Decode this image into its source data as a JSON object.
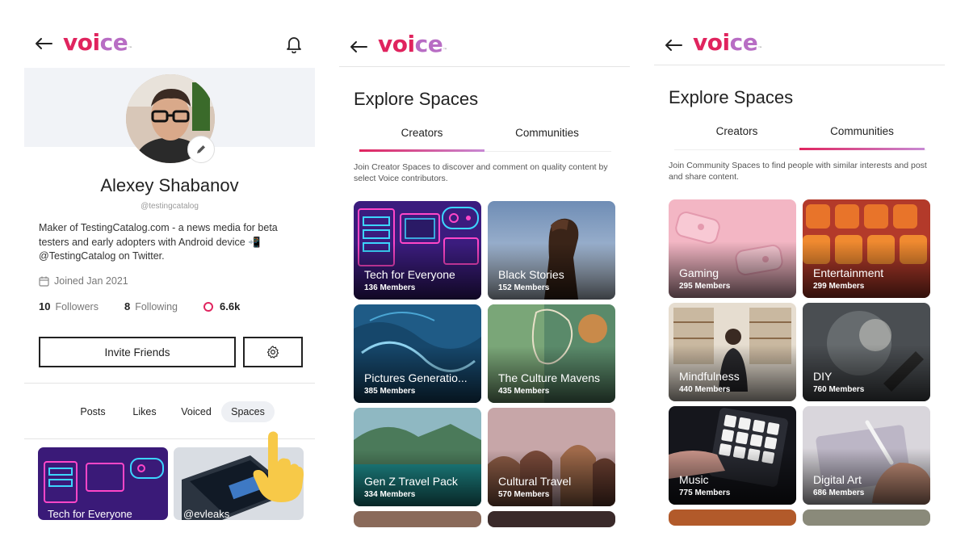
{
  "brand": {
    "logo_a": "voi",
    "logo_b": "ce",
    "tm": "™"
  },
  "profile": {
    "name": "Alexey Shabanov",
    "handle": "@testingcatalog",
    "bio": "Maker of TestingCatalog.com - a news media for beta testers and early adopters with Android device 📲 @TestingCatalog on Twitter.",
    "joined": "Joined Jan 2021",
    "followers_count": "10",
    "followers_label": "Followers",
    "following_count": "8",
    "following_label": "Following",
    "points": "6.6k",
    "invite_label": "Invite Friends",
    "tabs": [
      "Posts",
      "Likes",
      "Voiced",
      "Spaces"
    ],
    "thumbs": [
      {
        "title": "Tech for Everyone"
      },
      {
        "title": "@evleaks"
      }
    ]
  },
  "creators_screen": {
    "title": "Explore Spaces",
    "tabs": [
      "Creators",
      "Communities"
    ],
    "active_tab": "Creators",
    "description": "Join Creator Spaces to discover and comment on quality content by select Voice contributors.",
    "cards": [
      {
        "title": "Tech for Everyone",
        "members": "136 Members"
      },
      {
        "title": "Black Stories",
        "members": "152 Members"
      },
      {
        "title": "Pictures Generatio...",
        "members": "385 Members"
      },
      {
        "title": "The Culture Mavens",
        "members": "435 Members"
      },
      {
        "title": "Gen Z Travel Pack",
        "members": "334 Members"
      },
      {
        "title": "Cultural Travel",
        "members": "570 Members"
      }
    ]
  },
  "communities_screen": {
    "title": "Explore Spaces",
    "tabs": [
      "Creators",
      "Communities"
    ],
    "active_tab": "Communities",
    "description": "Join Community Spaces to find people with similar interests and post and share content.",
    "cards": [
      {
        "title": "Gaming",
        "members": "295 Members"
      },
      {
        "title": "Entertainment",
        "members": "299 Members"
      },
      {
        "title": "Mindfulness",
        "members": "440 Members"
      },
      {
        "title": "DIY",
        "members": "760 Members"
      },
      {
        "title": "Music",
        "members": "775 Members"
      },
      {
        "title": "Digital Art",
        "members": "686 Members"
      }
    ]
  },
  "colors": {
    "accent": "#e0245e",
    "accent_2": "#c889d4",
    "text": "#222222"
  }
}
